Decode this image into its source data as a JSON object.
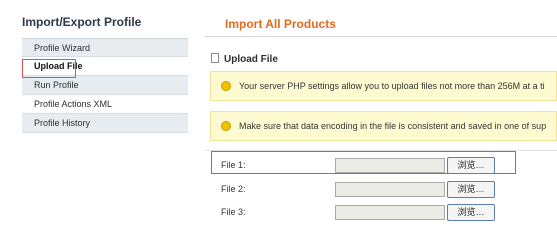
{
  "sidebar": {
    "title": "Import/Export Profile",
    "items": [
      {
        "label": "Profile Wizard"
      },
      {
        "label": "Upload File"
      },
      {
        "label": "Run Profile"
      },
      {
        "label": "Profile Actions XML"
      },
      {
        "label": "Profile History"
      }
    ]
  },
  "main": {
    "title": "Import All Products",
    "section_title": "Upload File",
    "notices": [
      "Your server PHP settings allow you to upload files not more than 256M at a ti",
      "Make sure that data encoding in the file is consistent and saved in one of sup"
    ],
    "files": [
      {
        "label": "File 1:",
        "value": "",
        "button": "浏览…"
      },
      {
        "label": "File 2:",
        "value": "",
        "button": "浏览…"
      },
      {
        "label": "File 3:",
        "value": "",
        "button": "浏览…"
      }
    ]
  },
  "colors": {
    "accent": "#e36a20",
    "highlight_box": "#e05050",
    "notice_bg": "#fffbd0"
  }
}
